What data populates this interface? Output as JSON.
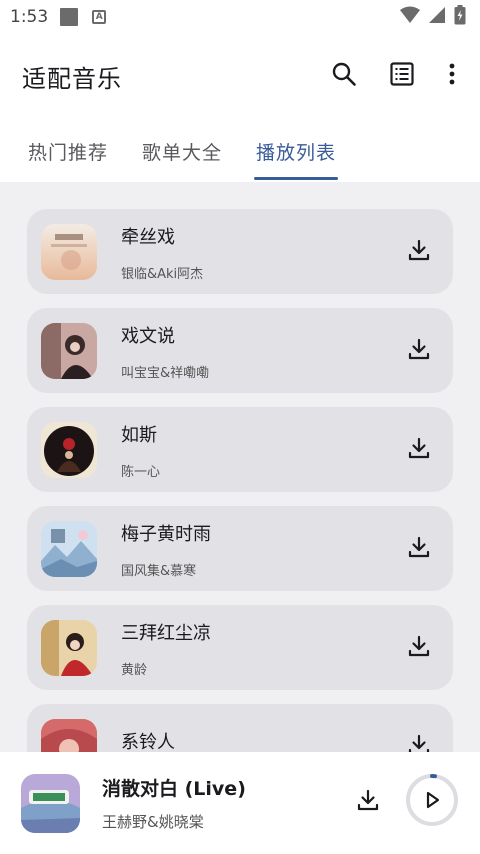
{
  "status_bar": {
    "time": "1:53",
    "notification_letter": "A"
  },
  "app_bar": {
    "title": "适配音乐"
  },
  "tabs": [
    {
      "label": "热门推荐",
      "active": false
    },
    {
      "label": "歌单大全",
      "active": false
    },
    {
      "label": "播放列表",
      "active": true
    }
  ],
  "songs": [
    {
      "title": "牵丝戏",
      "artist": "银临&Aki阿杰"
    },
    {
      "title": "戏文说",
      "artist": "叫宝宝&祥嘞嘞"
    },
    {
      "title": "如斯",
      "artist": "陈一心"
    },
    {
      "title": "梅子黄时雨",
      "artist": "国风集&慕寒"
    },
    {
      "title": "三拜红尘凉",
      "artist": "黄龄"
    },
    {
      "title": "系铃人",
      "artist": ""
    }
  ],
  "now_playing": {
    "title": "消散对白 (Live)",
    "artist": "王赫野&姚晓棠",
    "progress": 0.02
  },
  "colors": {
    "accent": "#3a5b9a",
    "card": "#e2e2e6",
    "list_bg": "#f0f0f2"
  }
}
